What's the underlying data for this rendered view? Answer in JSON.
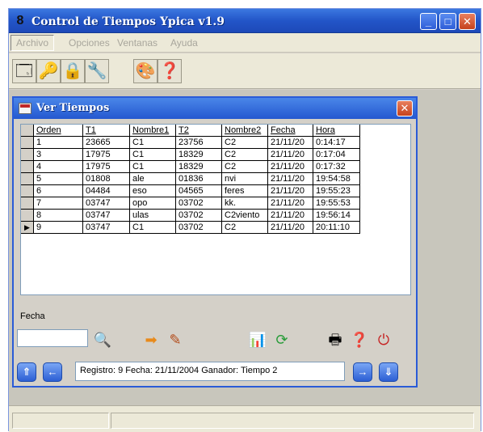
{
  "window": {
    "app_title": "Control de Tiempos Ypica v1.9"
  },
  "menu": {
    "items": [
      "Archivo",
      "Opciones",
      "Ventanas",
      "Ayuda"
    ]
  },
  "child": {
    "title": "Ver Tiempos"
  },
  "grid": {
    "columns": [
      "Orden",
      "T1",
      "Nombre1",
      "T2",
      "Nombre2",
      "Fecha",
      "Hora"
    ],
    "rows": [
      [
        "1",
        "23665",
        "C1",
        "23756",
        "C2",
        "21/11/20",
        "0:14:17"
      ],
      [
        "3",
        "17975",
        "C1",
        "18329",
        "C2",
        "21/11/20",
        "0:17:04"
      ],
      [
        "4",
        "17975",
        "C1",
        "18329",
        "C2",
        "21/11/20",
        "0:17:32"
      ],
      [
        "5",
        "01808",
        "ale",
        "01836",
        "nvi",
        "21/11/20",
        "19:54:58"
      ],
      [
        "6",
        "04484",
        "eso",
        "04565",
        "feres",
        "21/11/20",
        "19:55:23"
      ],
      [
        "7",
        "03747",
        "opo",
        "03702",
        "kk.",
        "21/11/20",
        "19:55:53"
      ],
      [
        "8",
        "03747",
        "ulas",
        "03702",
        "C2viento",
        "21/11/20",
        "19:56:14"
      ],
      [
        "9",
        "03747",
        "C1",
        "03702",
        "C2",
        "21/11/20",
        "20:11:10"
      ]
    ],
    "current_row_marker": "▶"
  },
  "panel": {
    "fecha_label": "Fecha",
    "fecha_value": "",
    "status_text": "Registro:  9  Fecha:  21/11/2004  Ganador:  Tiempo 2"
  },
  "icons": {
    "toolbar": [
      "window-icon",
      "key-icon",
      "lock-icon",
      "plugin-icon",
      "palette-icon",
      "help-icon"
    ],
    "panel": [
      "search-icon",
      "arrow-right-icon",
      "edit-icon",
      "chart-icon",
      "refresh-icon",
      "print-icon",
      "help-icon",
      "power-icon"
    ],
    "nav": [
      "first-icon",
      "prev-icon",
      "next-icon",
      "last-icon"
    ]
  },
  "colors": {
    "titlebar": "#2355c8",
    "close_button": "#c6421d",
    "workspace": "#c8c6bc"
  }
}
